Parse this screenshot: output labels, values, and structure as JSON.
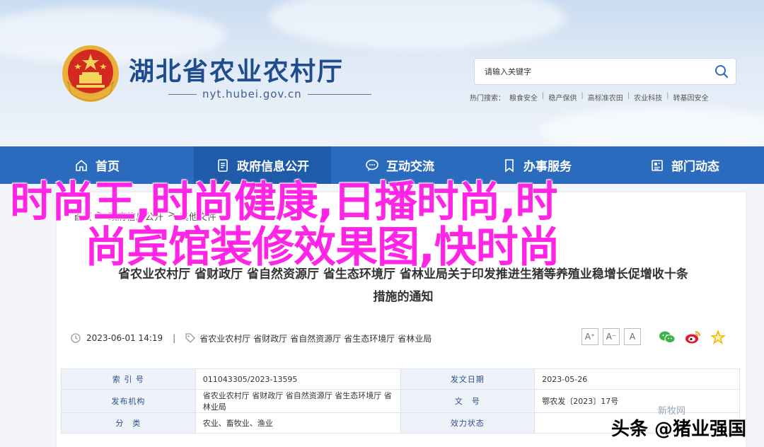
{
  "header": {
    "site_title": "湖北省农业农村厅",
    "site_domain": "nyt.hubei.gov.cn",
    "search_placeholder": "请输入关键字",
    "hot_label": "热门搜索：",
    "hot_items": [
      "粮食安全",
      "稳产保供",
      "高标准农田",
      "农业科技",
      "转基因安全"
    ]
  },
  "nav": [
    {
      "label": "首页",
      "icon": "home-icon"
    },
    {
      "label": "政府信息公开",
      "icon": "document-icon"
    },
    {
      "label": "互动交流",
      "icon": "chat-icon"
    },
    {
      "label": "办事服务",
      "icon": "bookmark-icon"
    },
    {
      "label": "部门动态",
      "icon": "news-icon"
    }
  ],
  "breadcrumb": [
    "首页",
    ">",
    "政府信息公开",
    ">",
    "其他文件"
  ],
  "overlay": {
    "line1": "时尚王,时尚健康,日播时尚,时",
    "line2": "尚宾馆装修效果图,快时尚",
    "color": "#ff24e6"
  },
  "article": {
    "title_line1": "省农业农村厅 省财政厅 省自然资源厅 省生态环境厅 省林业局关于印发推进生猪等养殖业稳增长促增收十条",
    "title_line2": "措施的通知",
    "datetime": "2023-06-01 14:19",
    "sep": "|",
    "sources": [
      "省农业农村厅",
      "省财政厅",
      "省自然资源厅",
      "省生态环境厅",
      "省林业局"
    ],
    "font_buttons": [
      "A⁺",
      "A⁻",
      "A"
    ]
  },
  "info_table": [
    {
      "k1": "索 引 号",
      "v1": "011043305/2023-13595",
      "k2": "发文日期",
      "v2": "2023-05-26"
    },
    {
      "k1": "发布机构",
      "v1": "省农业农村厅 省财政厅 省自然资源厅 省生态环境厅 省林业局",
      "k2": "文　号",
      "v2": "鄂农发〔2023〕17号"
    },
    {
      "k1": "分　类",
      "v1": "农业、畜牧业、渔业",
      "k2": "效力状态",
      "v2": ""
    }
  ],
  "watermark": {
    "brand": "新牧网",
    "text": "头条 @猪业强国"
  },
  "colors": {
    "nav_bg": "#2b6bbd",
    "nav_active": "#1f5ba8",
    "title_blue": "#1f4c8c"
  }
}
